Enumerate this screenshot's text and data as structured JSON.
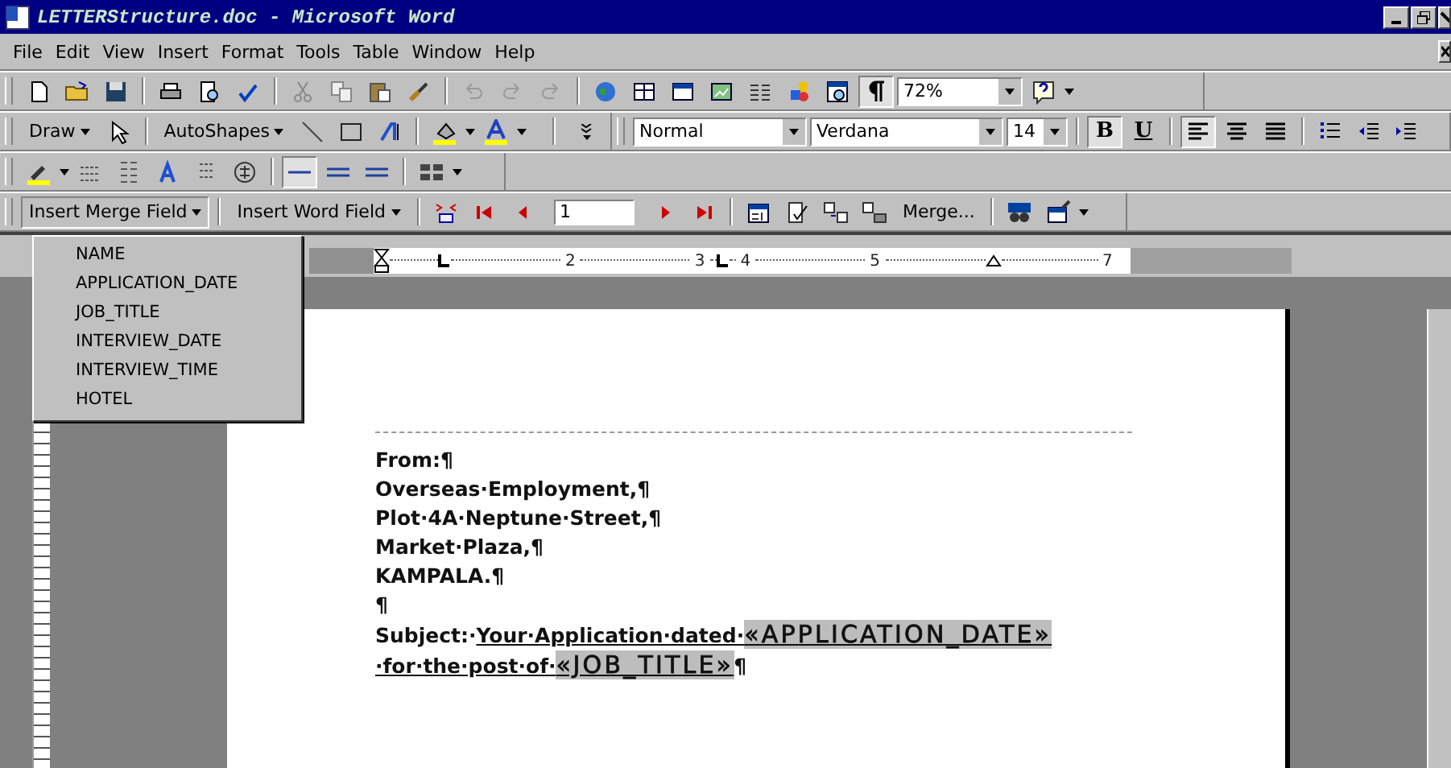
{
  "window": {
    "title": "LETTERStructure.doc - Microsoft Word"
  },
  "menu_bar": [
    "File",
    "Edit",
    "View",
    "Insert",
    "Format",
    "Tools",
    "Table",
    "Window",
    "Help"
  ],
  "standard_toolbar": {
    "show_marks": true,
    "zoom": "72%"
  },
  "drawing_toolbar": {
    "draw": "Draw",
    "autoshapes": "AutoShapes"
  },
  "formatting_toolbar": {
    "style": "Normal",
    "font": "Verdana",
    "size": "14",
    "bold": {
      "label": "B",
      "pressed": true
    },
    "underline": {
      "label": "U",
      "pressed": false
    },
    "align": [
      {
        "selected": true
      },
      {
        "selected": false
      },
      {
        "selected": false
      }
    ]
  },
  "line_styles": [
    {
      "selected": true
    },
    {
      "selected": false
    },
    {
      "selected": false
    }
  ],
  "mail_merge_toolbar": {
    "insert_merge_field": {
      "label": "Insert Merge Field",
      "pressed": true
    },
    "insert_word_field": "Insert Word Field",
    "record": "1",
    "merge": "Merge..."
  },
  "merge_field_menu": [
    "NAME",
    "APPLICATION_DATE",
    "JOB_TITLE",
    "INTERVIEW_DATE",
    "INTERVIEW_TIME",
    "HOTEL"
  ],
  "ruler": {
    "labels": [
      "2",
      "3",
      "4",
      "5",
      "7"
    ]
  },
  "document": {
    "paragraphs": [
      [
        {
          "kind": "plain",
          "text": "From:¶"
        }
      ],
      [
        {
          "kind": "plain",
          "text": "Overseas·Employment,¶"
        }
      ],
      [
        {
          "kind": "plain",
          "text": "Plot·4A·Neptune·Street,¶"
        }
      ],
      [
        {
          "kind": "plain",
          "text": "Market·Plaza,¶"
        }
      ],
      [
        {
          "kind": "plain",
          "text": "KAMPALA.¶"
        }
      ],
      [
        {
          "kind": "plain",
          "text": "¶"
        }
      ],
      [
        {
          "kind": "plain",
          "text": "Subject:·"
        },
        {
          "kind": "underline",
          "text": "Your·Application·dated·"
        },
        {
          "kind": "field",
          "text": "«APPLICATION_DATE»"
        },
        {
          "kind": "underline",
          "text": "·for·the·post·of·"
        },
        {
          "kind": "field",
          "text": "«JOB_TITLE»"
        },
        {
          "kind": "plain",
          "text": "¶"
        }
      ]
    ]
  }
}
